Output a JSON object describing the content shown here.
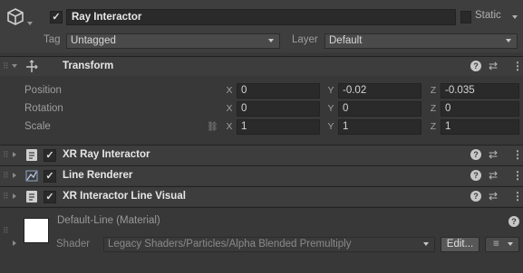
{
  "gameobject": {
    "active": true,
    "name": "Ray Interactor",
    "static_label": "Static",
    "tag_label": "Tag",
    "tag_value": "Untagged",
    "layer_label": "Layer",
    "layer_value": "Default"
  },
  "transform": {
    "title": "Transform",
    "rows": [
      {
        "label": "Position",
        "x": "0",
        "y": "-0.02",
        "z": "-0.035"
      },
      {
        "label": "Rotation",
        "x": "0",
        "y": "0",
        "z": "0"
      },
      {
        "label": "Scale",
        "x": "1",
        "y": "1",
        "z": "1"
      }
    ],
    "axis_x": "X",
    "axis_y": "Y",
    "axis_z": "Z"
  },
  "components": [
    {
      "title": "XR Ray Interactor",
      "enabled": true
    },
    {
      "title": "Line Renderer",
      "enabled": true
    },
    {
      "title": "XR Interactor Line Visual",
      "enabled": true
    }
  ],
  "material": {
    "name": "Default-Line (Material)",
    "shader_label": "Shader",
    "shader_value": "Legacy Shaders/Particles/Alpha Blended Premultiply",
    "edit_label": "Edit...",
    "list_icon": "≡"
  },
  "icons": {
    "check": "✓",
    "help": "?",
    "preset": "⇄",
    "kebab": "⋮"
  },
  "colors": {
    "background": "#383838",
    "field": "#2a2a2a",
    "header": "#3d3d3d"
  }
}
